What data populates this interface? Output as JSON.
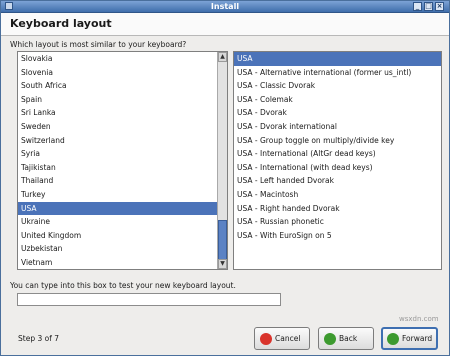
{
  "window": {
    "title": "Install"
  },
  "header": {
    "title": "Keyboard layout"
  },
  "question": "Which layout is most similar to your keyboard?",
  "countries": [
    "Slovakia",
    "Slovenia",
    "South Africa",
    "Spain",
    "Sri Lanka",
    "Sweden",
    "Switzerland",
    "Syria",
    "Tajikistan",
    "Thailand",
    "Turkey",
    "USA",
    "Ukraine",
    "United Kingdom",
    "Uzbekistan",
    "Vietnam"
  ],
  "countries_selected": "USA",
  "variants": [
    "USA",
    "USA - Alternative international (former us_intl)",
    "USA - Classic Dvorak",
    "USA - Colemak",
    "USA - Dvorak",
    "USA - Dvorak international",
    "USA - Group toggle on multiply/divide key",
    "USA - International (AltGr dead keys)",
    "USA - International (with dead keys)",
    "USA - Left handed Dvorak",
    "USA - Macintosh",
    "USA - Right handed Dvorak",
    "USA - Russian phonetic",
    "USA - With EuroSign on 5"
  ],
  "variants_selected": "USA",
  "test_prompt": "You can type into this box to test your new keyboard layout.",
  "test_value": "",
  "step": "Step 3 of 7",
  "buttons": {
    "cancel": "Cancel",
    "back": "Back",
    "forward": "Forward"
  },
  "watermark": "wsxdn.com",
  "colors": {
    "selection": "#4b73b9",
    "titlebar": "#3f6eab",
    "cancel_icon": "#d9332b",
    "back_icon": "#3c9a2f",
    "forward_icon": "#3c9a2f"
  }
}
